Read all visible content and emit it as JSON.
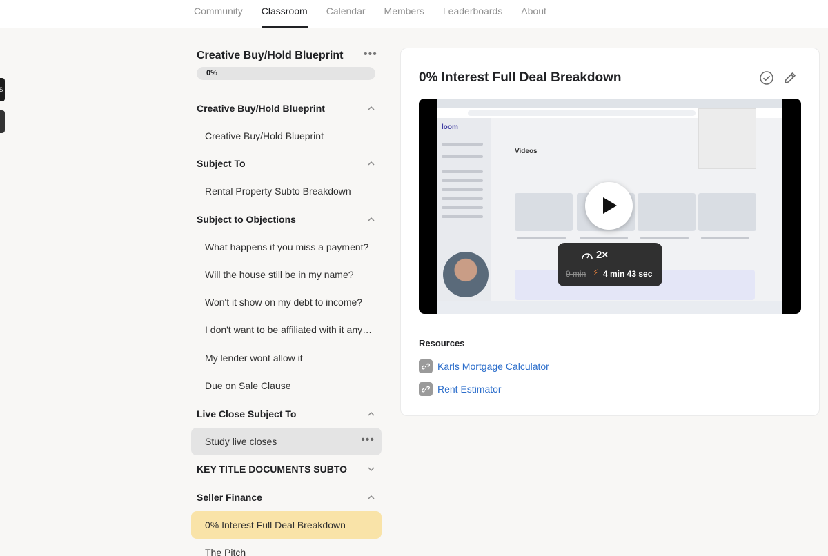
{
  "nav": {
    "tabs": [
      "Community",
      "Classroom",
      "Calendar",
      "Members",
      "Leaderboards",
      "About"
    ],
    "active": "Classroom"
  },
  "course": {
    "title": "Creative Buy/Hold Blueprint",
    "menu": "•••",
    "progress_label": "0%",
    "progress": 0
  },
  "sections": [
    {
      "title": "Creative Buy/Hold Blueprint",
      "expanded": true,
      "lessons": [
        "Creative Buy/Hold Blueprint"
      ]
    },
    {
      "title": "Subject To",
      "expanded": true,
      "lessons": [
        "Rental Property Subto Breakdown"
      ]
    },
    {
      "title": "Subject to Objections",
      "expanded": true,
      "lessons": [
        "What happens if you miss a payment?",
        "Will the house still be in my name?",
        "Won't it show on my debt to income?",
        "I don't want to be affiliated with it anymore",
        "My lender wont allow it",
        "Due on Sale Clause"
      ]
    },
    {
      "title": "Live Close Subject To",
      "expanded": true,
      "lessons": [
        "Study live closes"
      ]
    },
    {
      "title": "KEY TITLE DOCUMENTS SUBTO",
      "expanded": false,
      "lessons": []
    },
    {
      "title": "Seller Finance",
      "expanded": true,
      "lessons": [
        "0% Interest Full Deal Breakdown",
        "The Pitch"
      ]
    }
  ],
  "lesson_menu": "•••",
  "content": {
    "title": "0% Interest Full Deal Breakdown",
    "video": {
      "rate": "2×",
      "old_duration": "9 min",
      "new_duration": "4 min 43 sec",
      "screen_logo": "loom",
      "screen_heading": "Videos"
    },
    "resources_title": "Resources",
    "resources": [
      "Karls Mortgage Calculator",
      "Rent Estimator"
    ]
  },
  "colors": {
    "accent_link": "#2c6ecb",
    "current_lesson_bg": "#f9e3a8",
    "hover_lesson_bg": "#e4e4e4"
  },
  "icons": {
    "complete": "check-circle-icon",
    "edit": "pencil-icon",
    "resource": "link-icon",
    "play": "play-icon",
    "speed": "speedometer-icon"
  }
}
